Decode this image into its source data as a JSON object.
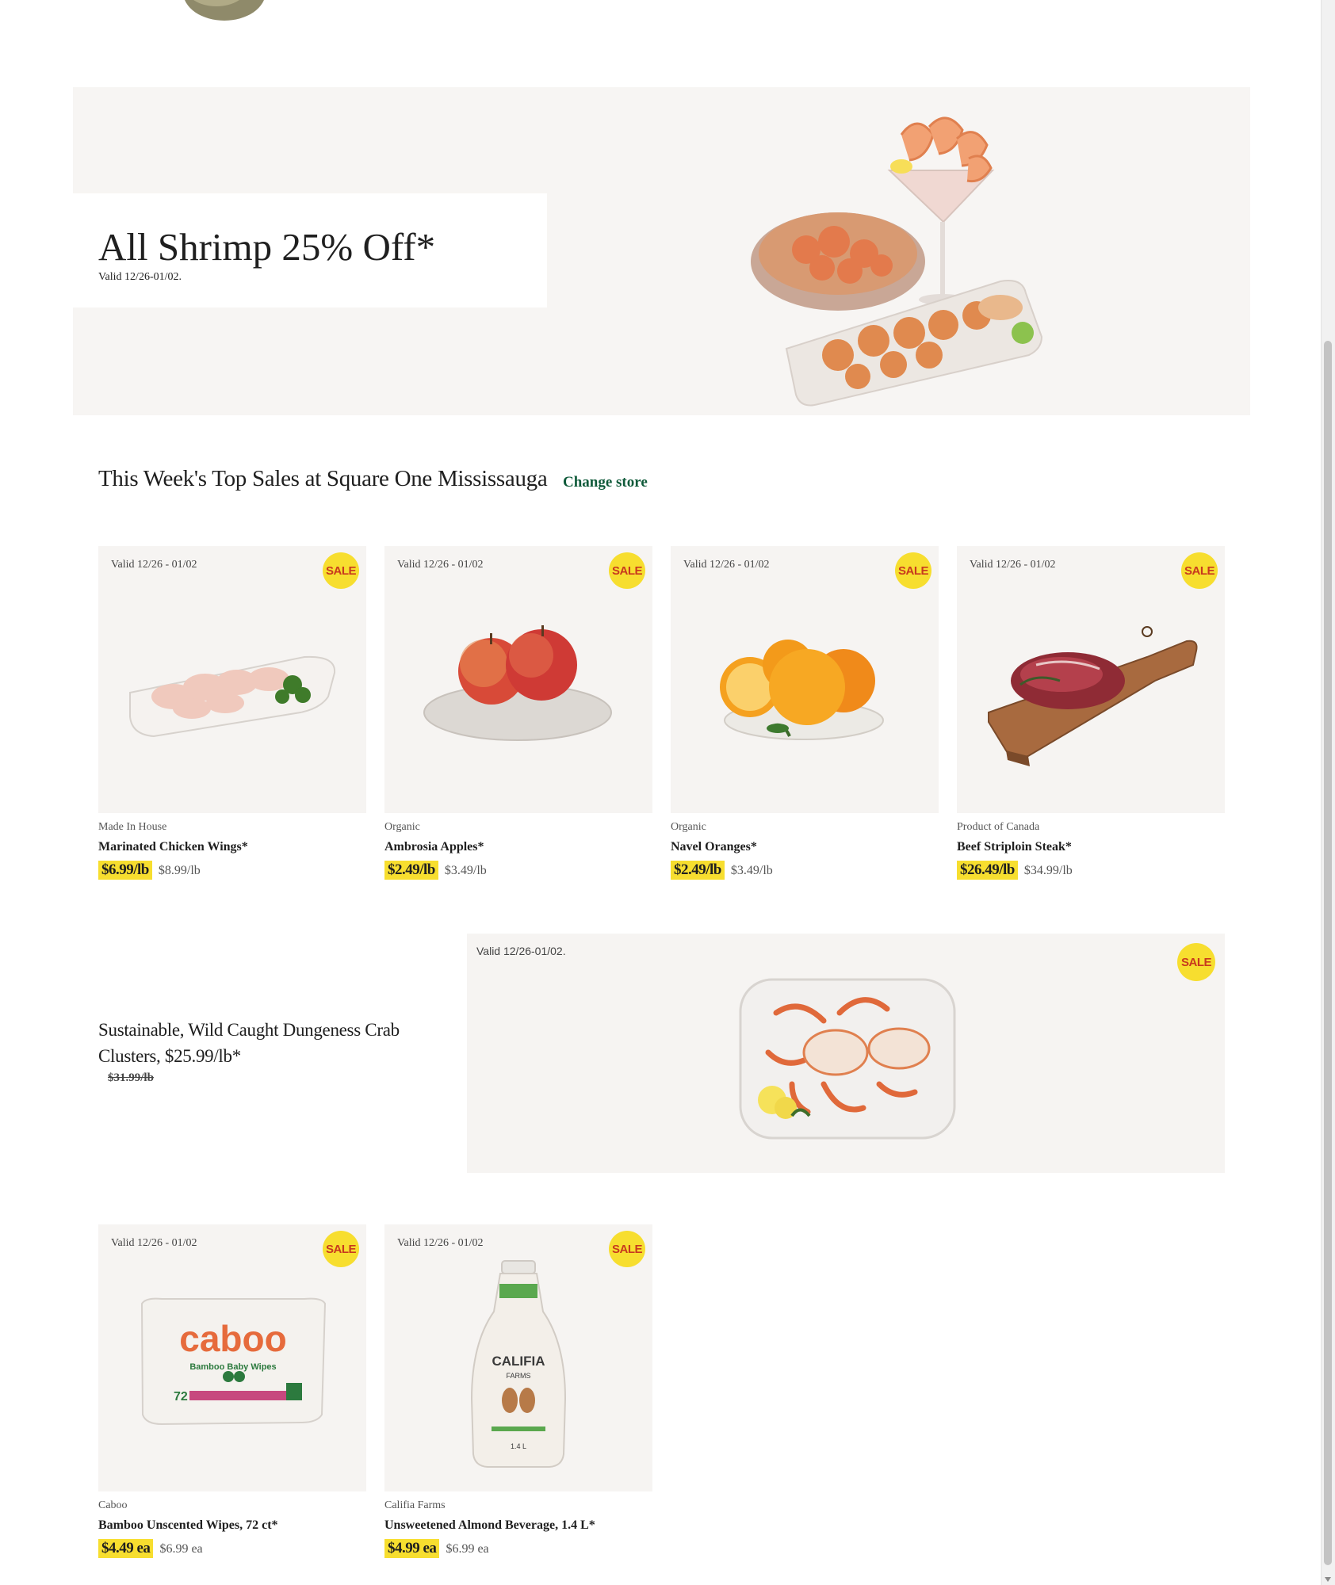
{
  "colors": {
    "sale_yellow": "#f7de2f",
    "sale_text": "#c8391e",
    "link_green": "#0f5a3a",
    "panel_bg": "#f6f4f2"
  },
  "hero": {
    "title": "All Shrimp 25% Off*",
    "valid": "Valid 12/26-01/02.",
    "image_icon": "shrimp-platter-image"
  },
  "section": {
    "title": "This Week's Top Sales at Square One Mississauga",
    "change_store": "Change store"
  },
  "sale_badge": "SALE",
  "products": [
    {
      "valid": "Valid 12/26 - 01/02",
      "brand": "Made In House",
      "name": "Marinated Chicken Wings*",
      "sale_price": "$6.99/lb",
      "reg_price": "$8.99/lb"
    },
    {
      "valid": "Valid 12/26 - 01/02",
      "brand": "Organic",
      "name": "Ambrosia Apples*",
      "sale_price": "$2.49/lb",
      "reg_price": "$3.49/lb"
    },
    {
      "valid": "Valid 12/26 - 01/02",
      "brand": "Organic",
      "name": "Navel Oranges*",
      "sale_price": "$2.49/lb",
      "reg_price": "$3.49/lb"
    },
    {
      "valid": "Valid 12/26 - 01/02",
      "brand": "Product of Canada",
      "name": "Beef Striploin Steak*",
      "sale_price": "$26.49/lb",
      "reg_price": "$34.99/lb"
    },
    {
      "valid": "Valid 12/26 - 01/02",
      "brand": "Caboo",
      "name": "Bamboo Unscented Wipes, 72 ct*",
      "sale_price": "$4.49 ea",
      "reg_price": "$6.99 ea"
    },
    {
      "valid": "Valid 12/26 - 01/02",
      "brand": "Califia Farms",
      "name": "Unsweetened Almond Beverage, 1.4 L*",
      "sale_price": "$4.99 ea",
      "reg_price": "$6.99 ea"
    }
  ],
  "feature": {
    "title": "Sustainable, Wild Caught Dungeness Crab Clusters, $25.99/lb*",
    "was_price": "$31.99/lb",
    "valid": "Valid 12/26-01/02."
  },
  "product_art": {
    "caboo_logo": "caboo",
    "caboo_sub": "Bamboo Baby Wipes",
    "caboo_count": "72",
    "califia_logo": "CALIFIA",
    "califia_sub": "FARMS",
    "califia_size": "1.4 L"
  }
}
